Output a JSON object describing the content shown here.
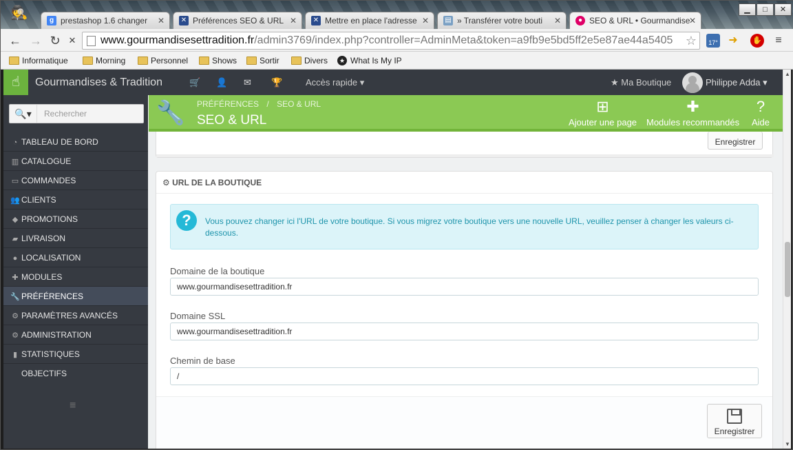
{
  "browser": {
    "tabs": [
      {
        "label": "prestashop 1.6 changer",
        "favicon": "google-icon",
        "color": "#4285f4"
      },
      {
        "label": "Préférences SEO & URL",
        "favicon": "prestashop-icon",
        "color": "#2a4b8d"
      },
      {
        "label": "Mettre en place l'adresse",
        "favicon": "prestashop-icon",
        "color": "#2a4b8d"
      },
      {
        "label": "» Transférer votre bouti",
        "favicon": "page-icon",
        "color": "#7aa0c4"
      },
      {
        "label": "SEO & URL • Gourmandise",
        "favicon": "prestashop-pink-icon",
        "color": "#df0067"
      }
    ],
    "url_host": "www.gourmandisesettradition.fr",
    "url_path": "/admin3769/index.php?controller=AdminMeta&token=a9fb9e5bd5ff2e5e87ae44a5405",
    "bookmarks": [
      "Informatique",
      "Morning",
      "Personnel",
      "Shows",
      "Sortir",
      "Divers",
      "What Is My IP"
    ],
    "weather_badge": "17°"
  },
  "header": {
    "shop_name": "Gourmandises & Tradition",
    "quick_access": "Accès rapide",
    "my_shop": "Ma Boutique",
    "user": "Philippe Adda"
  },
  "sidebar": {
    "search_placeholder": "Rechercher",
    "items": [
      {
        "label": "TABLEAU DE BORD",
        "icon": "dashboard-icon"
      },
      {
        "label": "CATALOGUE",
        "icon": "book-icon"
      },
      {
        "label": "COMMANDES",
        "icon": "credit-card-icon"
      },
      {
        "label": "CLIENTS",
        "icon": "users-icon"
      },
      {
        "label": "PROMOTIONS",
        "icon": "tag-icon"
      },
      {
        "label": "LIVRAISON",
        "icon": "truck-icon"
      },
      {
        "label": "LOCALISATION",
        "icon": "globe-icon"
      },
      {
        "label": "MODULES",
        "icon": "puzzle-icon"
      },
      {
        "label": "PRÉFÉRENCES",
        "icon": "wrench-icon"
      },
      {
        "label": "PARAMÈTRES AVANCÉS",
        "icon": "cogs-icon"
      },
      {
        "label": "ADMINISTRATION",
        "icon": "cog-icon"
      },
      {
        "label": "STATISTIQUES",
        "icon": "bar-chart-icon"
      },
      {
        "label": "OBJECTIFS",
        "icon": ""
      }
    ]
  },
  "page_toolbar": {
    "breadcrumb_1": "PRÉFÉRENCES",
    "breadcrumb_sep": "/",
    "breadcrumb_2": "SEO & URL",
    "title": "SEO & URL",
    "add_page": "Ajouter une page",
    "recommended_modules": "Modules recommandés",
    "help": "Aide"
  },
  "main": {
    "top_save_label": "Enregistrer",
    "panel_title": "URL DE LA BOUTIQUE",
    "info_text": "Vous pouvez changer ici l'URL de votre boutique. Si vous migrez votre boutique vers une nouvelle URL, veuillez penser à changer les valeurs ci-dessous.",
    "fields": [
      {
        "label": "Domaine de la boutique",
        "value": "www.gourmandisesettradition.fr"
      },
      {
        "label": "Domaine SSL",
        "value": "www.gourmandisesettradition.fr"
      },
      {
        "label": "Chemin de base",
        "value": "/"
      }
    ],
    "save_label": "Enregistrer"
  }
}
